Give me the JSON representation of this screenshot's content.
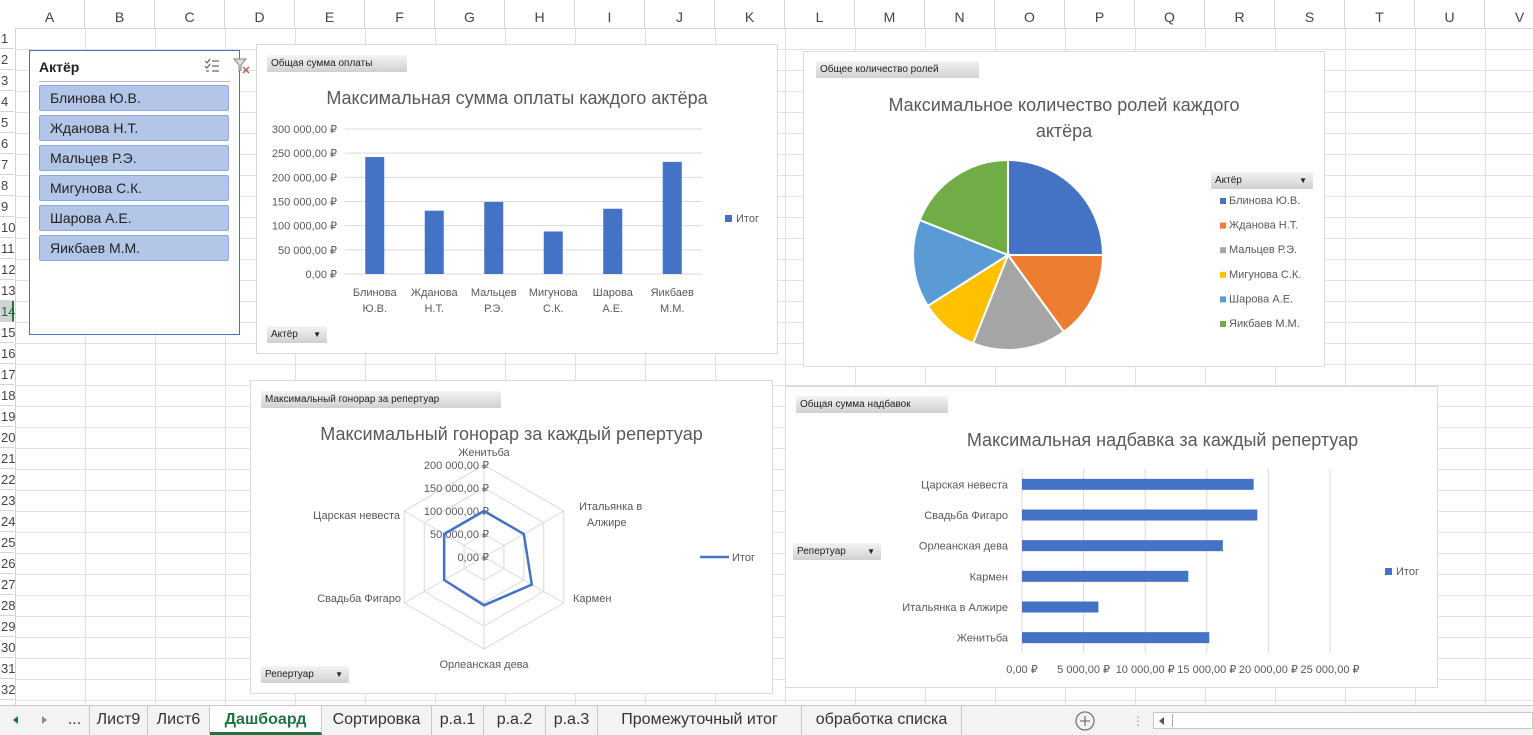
{
  "sheet": {
    "columns": [
      "A",
      "B",
      "C",
      "D",
      "E",
      "F",
      "G",
      "H",
      "I",
      "J",
      "K",
      "L",
      "M",
      "N",
      "O",
      "P",
      "Q",
      "R",
      "S",
      "T",
      "U",
      "V"
    ],
    "rows": [
      "1",
      "2",
      "3",
      "4",
      "5",
      "6",
      "7",
      "8",
      "9",
      "10",
      "11",
      "12",
      "13",
      "14",
      "15",
      "16",
      "17",
      "18",
      "19",
      "20",
      "21",
      "22",
      "23",
      "24",
      "25",
      "26",
      "27",
      "28",
      "29",
      "30",
      "31",
      "32"
    ],
    "selected_row": "14"
  },
  "slicer": {
    "title": "Актёр",
    "items": [
      "Блинова Ю.В.",
      "Жданова Н.Т.",
      "Мальцев Р.Э.",
      "Мигунова С.К.",
      "Шарова А.Е.",
      "Яикбаев М.М."
    ]
  },
  "charts": {
    "bar": {
      "value_button": "Общая сумма оплаты",
      "title": "Максимальная сумма оплаты каждого актёра",
      "axis_button": "Актёр",
      "legend": "Итог",
      "color": "#4472c4"
    },
    "pie": {
      "value_button": "Общее количество ролей",
      "title_line1": "Максимальное количество ролей каждого",
      "title_line2": "актёра",
      "legend_button": "Актёр"
    },
    "radar": {
      "value_button": "Максимальный гонорар за репертуар",
      "title": "Максимальный гонорар за каждый репертуар",
      "axis_button": "Репертуар",
      "legend": "Итог"
    },
    "hbar": {
      "value_button": "Общая сумма надбавок",
      "title": "Максимальная надбавка за каждый репертуар",
      "axis_button": "Репертуар",
      "legend": "Итог"
    }
  },
  "chart_data": [
    {
      "type": "bar",
      "title": "Максимальная сумма оплаты каждого актёра",
      "categories": [
        "Блинова Ю.В.",
        "Жданова Н.Т.",
        "Мальцев Р.Э.",
        "Мигунова С.К.",
        "Шарова А.Е.",
        "Яикбаев М.М."
      ],
      "series": [
        {
          "name": "Итог",
          "values": [
            242000,
            131000,
            149000,
            88000,
            135000,
            232000
          ]
        }
      ],
      "ylim": [
        0,
        300000
      ],
      "yticks": [
        "0,00 ₽",
        "50 000,00 ₽",
        "100 000,00 ₽",
        "150 000,00 ₽",
        "200 000,00 ₽",
        "250 000,00 ₽",
        "300 000,00 ₽"
      ],
      "grid": true,
      "legend": "right"
    },
    {
      "type": "pie",
      "title": "Максимальное количество ролей каждого актёра",
      "categories": [
        "Блинова Ю.В.",
        "Жданова Н.Т.",
        "Мальцев Р.Э.",
        "Мигунова С.К.",
        "Шарова А.Е.",
        "Яикбаев М.М."
      ],
      "values": [
        25,
        15,
        16,
        10,
        15,
        19
      ],
      "colors": [
        "#4472c4",
        "#ed7d31",
        "#a5a5a5",
        "#ffc000",
        "#5b9bd5",
        "#70ad47"
      ],
      "legend": "right"
    },
    {
      "type": "radar",
      "title": "Максимальный гонорар за каждый репертуар",
      "categories": [
        "Женитьба",
        "Итальянка в Алжире",
        "Кармен",
        "Орлеанская дева",
        "Свадьба Фигаро",
        "Царская невеста"
      ],
      "series": [
        {
          "name": "Итог",
          "values": [
            100000,
            100000,
            120000,
            105000,
            100000,
            100000
          ]
        }
      ],
      "rlim": [
        0,
        200000
      ],
      "rticks": [
        "0,00 ₽",
        "50 000,00 ₽",
        "100 000,00 ₽",
        "150 000,00 ₽",
        "200 000,00 ₽"
      ],
      "legend": "right"
    },
    {
      "type": "bar",
      "orientation": "horizontal",
      "title": "Максимальная надбавка за каждый репертуар",
      "categories": [
        "Царская невеста",
        "Свадьба Фигаро",
        "Орлеанская дева",
        "Кармен",
        "Итальянка в Алжире",
        "Женитьба"
      ],
      "series": [
        {
          "name": "Итог",
          "values": [
            18800,
            19100,
            16300,
            13500,
            6200,
            15200
          ]
        }
      ],
      "xlim": [
        0,
        25000
      ],
      "xticks": [
        "0,00 ₽",
        "5 000,00 ₽",
        "10 000,00 ₽",
        "15 000,00 ₽",
        "20 000,00 ₽",
        "25 000,00 ₽"
      ],
      "grid": true,
      "legend": "right"
    }
  ],
  "tabs": {
    "more": "...",
    "items": [
      "Лист9",
      "Лист6",
      "Дашбоард",
      "Сортировка",
      "р.а.1",
      "р.а.2",
      "р.а.3",
      "Промежуточный итог",
      "обработка списка"
    ],
    "active": "Дашбоард"
  }
}
